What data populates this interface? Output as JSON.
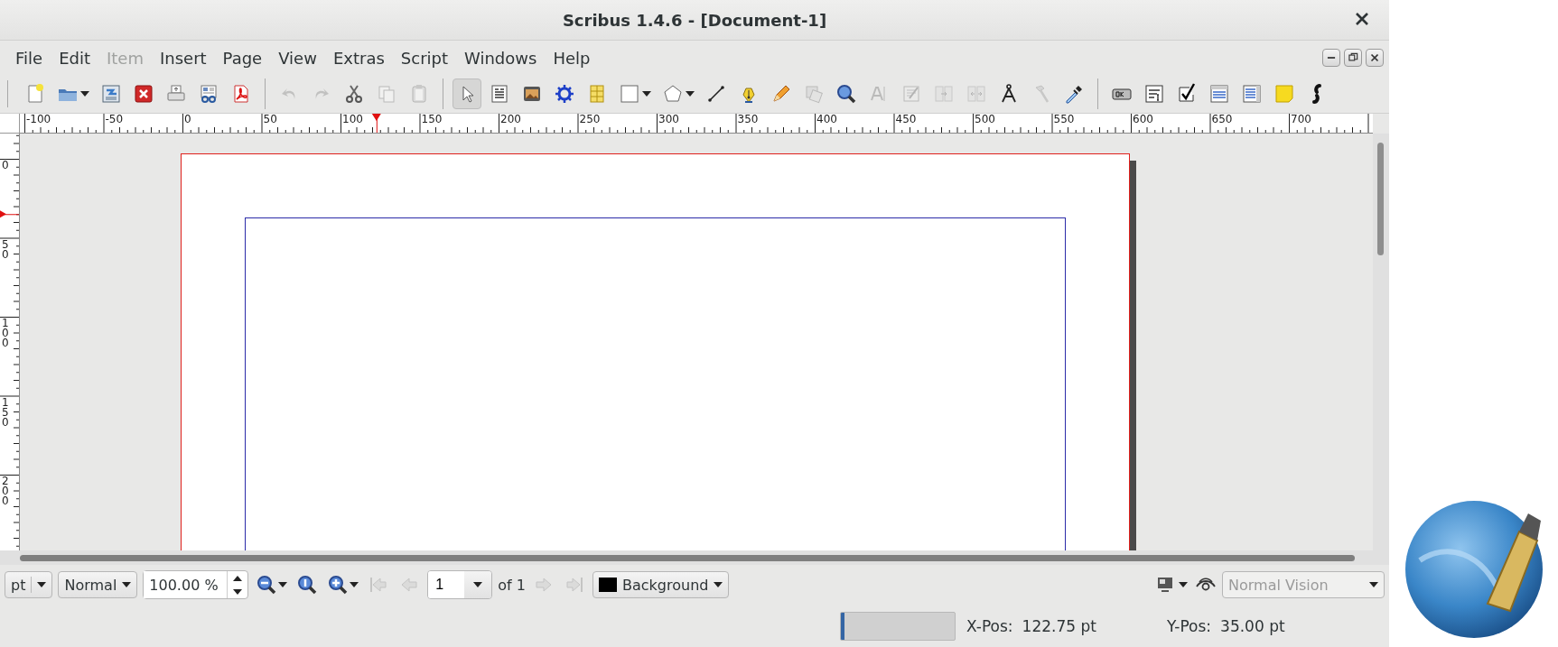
{
  "window": {
    "title": "Scribus 1.4.6 - [Document-1]"
  },
  "menu": [
    {
      "label": "File",
      "disabled": false
    },
    {
      "label": "Edit",
      "disabled": false
    },
    {
      "label": "Item",
      "disabled": true
    },
    {
      "label": "Insert",
      "disabled": false
    },
    {
      "label": "Page",
      "disabled": false
    },
    {
      "label": "View",
      "disabled": false
    },
    {
      "label": "Extras",
      "disabled": false
    },
    {
      "label": "Script",
      "disabled": false
    },
    {
      "label": "Windows",
      "disabled": false
    },
    {
      "label": "Help",
      "disabled": false
    }
  ],
  "toolbar": {
    "groups": [
      [
        {
          "disabled": false
        },
        {
          "disabled": false
        },
        {
          "disabled": false
        },
        {
          "disabled": false
        },
        {
          "disabled": false
        },
        {
          "disabled": false
        },
        {
          "disabled": false
        }
      ],
      [
        {
          "disabled": true
        },
        {
          "disabled": true
        },
        {
          "disabled": false
        },
        {
          "disabled": true
        },
        {
          "disabled": true
        }
      ],
      [
        {
          "disabled": false,
          "selected": true
        },
        {
          "disabled": false,
          "selected": false
        },
        {
          "disabled": false,
          "selected": false
        },
        {
          "disabled": false,
          "selected": false
        },
        {
          "disabled": false,
          "selected": false
        },
        {
          "disabled": false,
          "selected": false
        },
        {
          "disabled": false,
          "selected": false
        },
        {
          "disabled": false,
          "selected": false
        },
        {
          "disabled": false,
          "selected": false
        },
        {
          "disabled": false,
          "selected": false
        },
        {
          "disabled": true,
          "selected": false
        },
        {
          "disabled": false,
          "selected": false
        },
        {
          "disabled": true,
          "selected": false
        },
        {
          "disabled": true,
          "selected": false
        },
        {
          "disabled": true,
          "selected": false
        },
        {
          "disabled": true,
          "selected": false
        },
        {
          "disabled": false,
          "selected": false
        },
        {
          "disabled": true,
          "selected": false
        },
        {
          "disabled": false,
          "selected": false
        }
      ],
      [
        {
          "disabled": false
        },
        {
          "disabled": false
        },
        {
          "disabled": false
        },
        {
          "disabled": false
        },
        {
          "disabled": false
        },
        {
          "disabled": false
        },
        {
          "disabled": false
        }
      ]
    ]
  },
  "rulers": {
    "horizontal": [
      "-100",
      "-50",
      "0",
      "50",
      "100",
      "150",
      "200",
      "250",
      "300",
      "350",
      "400",
      "450",
      "500",
      "550",
      "600",
      "650",
      "700"
    ],
    "vertical": [
      "0",
      "50",
      "100",
      "150",
      "200"
    ]
  },
  "bottom_bar": {
    "unit": "pt",
    "mode": "Normal",
    "zoom": "100.00 %",
    "page": "1",
    "page_count": "of 1",
    "layer": "Background",
    "vision": "Normal Vision",
    "vision_disabled": true,
    "nav": [
      {
        "disabled": true
      },
      {
        "disabled": true
      },
      {
        "disabled": true
      },
      {
        "disabled": true
      }
    ]
  },
  "status": {
    "progress": {
      "level": 0.03
    },
    "x_label": "X-Pos:",
    "x_value": "122.75 pt",
    "y_label": "Y-Pos:",
    "y_value": "35.00 pt"
  }
}
